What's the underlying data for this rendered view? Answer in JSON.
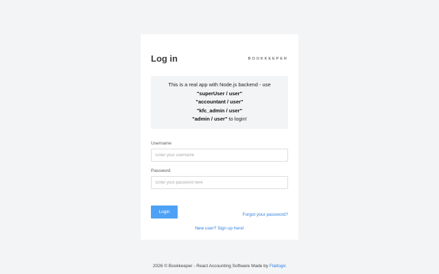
{
  "login": {
    "title": "Log in",
    "brand": "BOOKKEEPER",
    "notice": {
      "line1": "This is a real app with Node.js backend - use",
      "cred1": "\"superUser / user\"",
      "cred2": "\"accountant / user\"",
      "cred3": "\"kfc_admin / user\"",
      "cred4": "\"admin / user\"",
      "tail": " to login!"
    },
    "username_label": "Username",
    "username_placeholder": "Enter your username",
    "username_value": "",
    "password_label": "Password",
    "password_placeholder": "Enter your password here",
    "password_value": "",
    "login_button": "Login",
    "forgot_link": "Forgot your password?",
    "signup_link": "New user? Sign up here!"
  },
  "footer": {
    "text": "2026 © Bookkeeper - React Accounting Software Made by ",
    "link": "Flatlogic"
  },
  "colors": {
    "background": "#f3f4f6",
    "accent": "#4ea2f5",
    "link": "#2f7fe0"
  }
}
